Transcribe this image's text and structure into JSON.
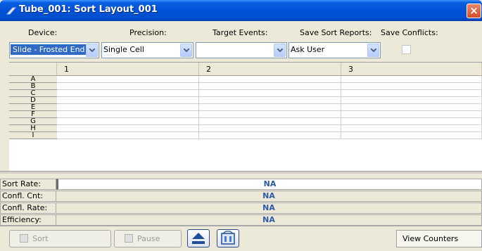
{
  "window": {
    "title": "Tube_001: Sort Layout_001",
    "close": "×"
  },
  "fields": {
    "device": {
      "label": "Device:",
      "value": "Slide - Frosted End"
    },
    "precision": {
      "label": "Precision:",
      "value": "Single Cell"
    },
    "target_events": {
      "label": "Target Events:",
      "value": ""
    },
    "save_sort_reports": {
      "label": "Save Sort Reports:",
      "value": "Ask User"
    },
    "save_conflicts": {
      "label": "Save Conflicts:",
      "checked": false
    }
  },
  "grid": {
    "columns": [
      "1",
      "2",
      "3"
    ],
    "rows": [
      "A",
      "B",
      "C",
      "D",
      "E",
      "F",
      "G",
      "H",
      "I"
    ]
  },
  "stats": {
    "sort_rate": {
      "label": "Sort Rate:",
      "value": "NA"
    },
    "confl_cnt": {
      "label": "Confl. Cnt:",
      "value": "NA"
    },
    "confl_rate": {
      "label": "Confl. Rate:",
      "value": "NA"
    },
    "efficiency": {
      "label": "Efficiency:",
      "value": "NA"
    }
  },
  "buttons": {
    "sort": "Sort",
    "pause": "Pause",
    "eject_icon": "eject-icon",
    "plate_icon": "plate-icon",
    "view_counters": "View Counters"
  },
  "colors": {
    "title_bar": "#0051d6",
    "stat_value": "#2f5aa8",
    "selection": "#316ac5"
  }
}
